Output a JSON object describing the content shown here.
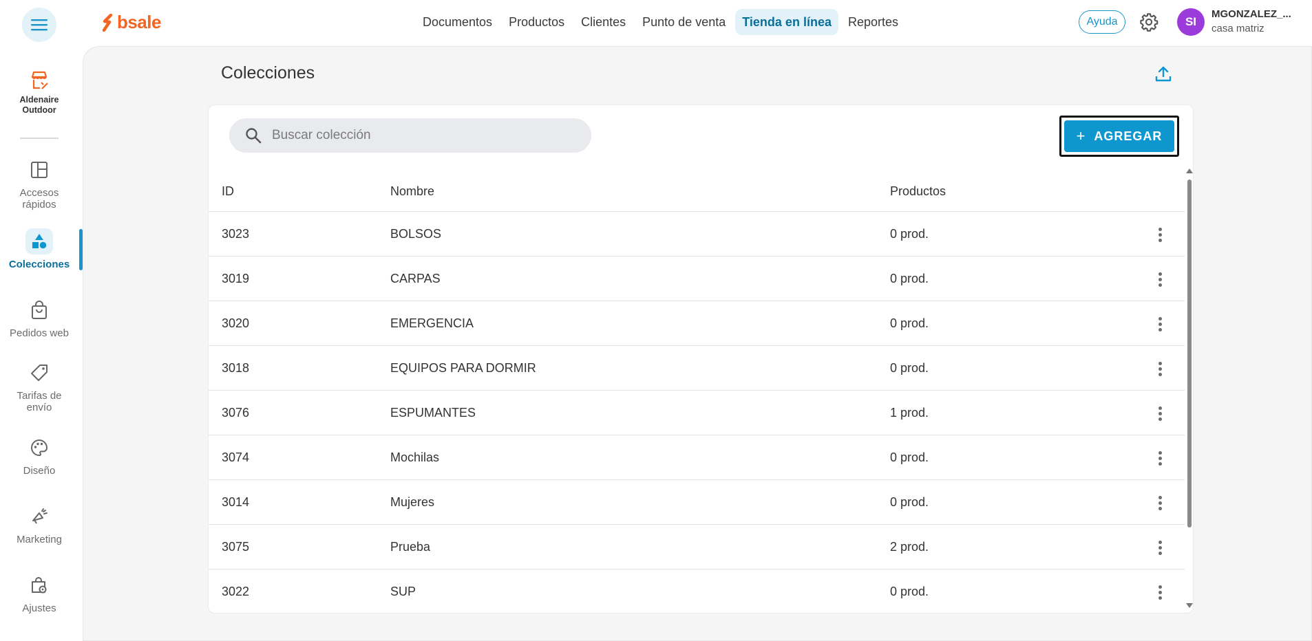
{
  "app": {
    "logo_text": "bsale",
    "brand_color": "#f26522",
    "accent_color": "#0e96cf"
  },
  "topnav": {
    "items": [
      {
        "label": "Documentos"
      },
      {
        "label": "Productos"
      },
      {
        "label": "Clientes"
      },
      {
        "label": "Punto de venta"
      },
      {
        "label": "Tienda en línea",
        "active": true
      },
      {
        "label": "Reportes"
      }
    ],
    "help_label": "Ayuda",
    "user": {
      "initials": "SI",
      "name": "MGONZALEZ_...",
      "subtitle": "casa matriz"
    }
  },
  "sidebar": {
    "store_name_line1": "Aldenaire",
    "store_name_line2": "Outdoor",
    "items": [
      {
        "label1": "Accesos",
        "label2": "rápidos",
        "icon": "layout-icon"
      },
      {
        "label1": "Colecciones",
        "label2": "",
        "icon": "shapes-icon",
        "active": true
      },
      {
        "label1": "Pedidos web",
        "label2": "",
        "icon": "shopping-bag-icon"
      },
      {
        "label1": "Tarifas de",
        "label2": "envío",
        "icon": "tag-icon"
      },
      {
        "label1": "Diseño",
        "label2": "",
        "icon": "palette-icon"
      },
      {
        "label1": "Marketing",
        "label2": "",
        "icon": "megaphone-icon"
      },
      {
        "label1": "Ajustes",
        "label2": "",
        "icon": "bag-gear-icon"
      }
    ]
  },
  "page": {
    "title": "Colecciones",
    "search_placeholder": "Buscar colección",
    "add_label": "AGREGAR",
    "add_plus": "+"
  },
  "table": {
    "columns": {
      "id": "ID",
      "name": "Nombre",
      "products": "Productos"
    },
    "rows": [
      {
        "id": "3023",
        "name": "BOLSOS",
        "products": "0 prod."
      },
      {
        "id": "3019",
        "name": "CARPAS",
        "products": "0 prod."
      },
      {
        "id": "3020",
        "name": "EMERGENCIA",
        "products": "0 prod."
      },
      {
        "id": "3018",
        "name": "EQUIPOS PARA DORMIR",
        "products": "0 prod."
      },
      {
        "id": "3076",
        "name": "ESPUMANTES",
        "products": "1 prod."
      },
      {
        "id": "3074",
        "name": "Mochilas",
        "products": "0 prod."
      },
      {
        "id": "3014",
        "name": "Mujeres",
        "products": "0 prod."
      },
      {
        "id": "3075",
        "name": "Prueba",
        "products": "2 prod."
      },
      {
        "id": "3022",
        "name": "SUP",
        "products": "0 prod."
      }
    ]
  }
}
